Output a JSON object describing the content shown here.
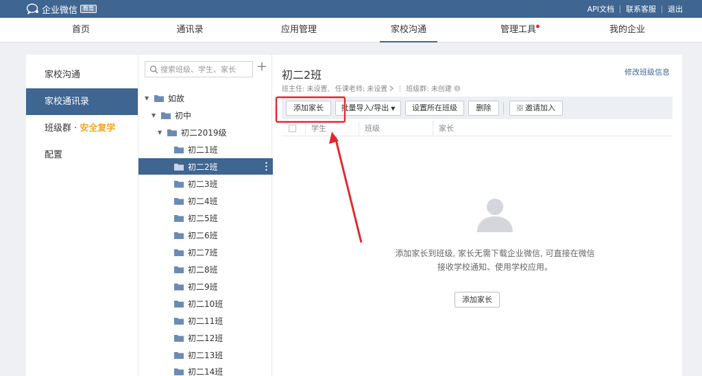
{
  "topbar": {
    "logo_text": "企业微信",
    "logo_badge": "教育",
    "links": [
      "API文档",
      "联系客服",
      "退出"
    ]
  },
  "nav": {
    "items": [
      "首页",
      "通讯录",
      "应用管理",
      "家校沟通",
      "管理工具",
      "我的企业"
    ],
    "active": "家校沟通"
  },
  "sidebar": {
    "items": [
      {
        "label": "家校沟通"
      },
      {
        "label": "家校通讯录"
      },
      {
        "label": "班级群 · ",
        "highlight": "安全复学"
      },
      {
        "label": "配置"
      }
    ]
  },
  "tree": {
    "search_placeholder": "搜索班级、学生、家长",
    "rows": [
      {
        "label": "如故"
      },
      {
        "label": "初中"
      },
      {
        "label": "初二2019级"
      },
      {
        "label": "初二1班"
      },
      {
        "label": "初二2班"
      },
      {
        "label": "初二3班"
      },
      {
        "label": "初二4班"
      },
      {
        "label": "初二5班"
      },
      {
        "label": "初二6班"
      },
      {
        "label": "初二7班"
      },
      {
        "label": "初二8班"
      },
      {
        "label": "初二9班"
      },
      {
        "label": "初二10班"
      },
      {
        "label": "初二11班"
      },
      {
        "label": "初二12班"
      },
      {
        "label": "初二13班"
      },
      {
        "label": "初二14班"
      }
    ]
  },
  "content": {
    "title": "初二2班",
    "edit_link": "修改班级信息",
    "meta": {
      "head_teacher": "班主任: 未设置,",
      "teachers": "任课老师: 未设置",
      "group": "班级群: 未创建"
    },
    "toolbar": {
      "add_parent": "添加家长",
      "batch": "批量导入/导出",
      "set_class": "设置所在班级",
      "delete": "删除",
      "invite": "邀请加入"
    },
    "columns": [
      "学生",
      "班级",
      "家长"
    ],
    "empty": {
      "line1": "添加家长到班级, 家长无需下载企业微信, 可直接在微信",
      "line2": "接收学校通知、使用学校应用。",
      "button": "添加家长"
    }
  },
  "colors": {
    "brand": "#3f6591",
    "highlight": "#f5a623",
    "annotation": "#e3262e"
  }
}
